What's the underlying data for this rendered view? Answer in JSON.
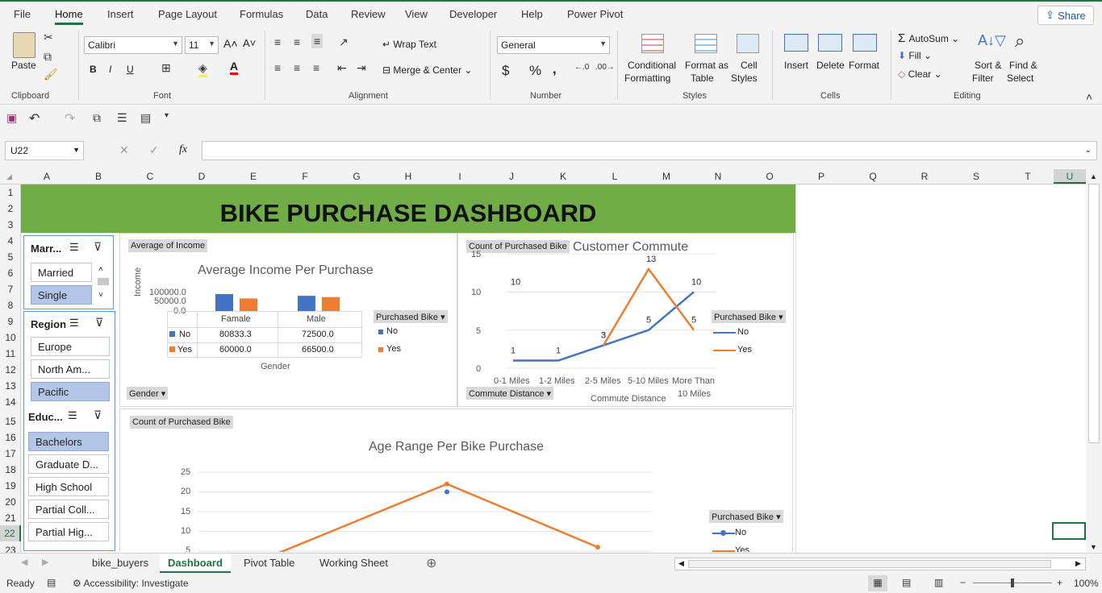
{
  "menu": {
    "tabs": [
      "File",
      "Home",
      "Insert",
      "Page Layout",
      "Formulas",
      "Data",
      "Review",
      "View",
      "Developer",
      "Help",
      "Power Pivot"
    ],
    "share": "Share"
  },
  "ribbon": {
    "clipboard": {
      "paste": "Paste",
      "label": "Clipboard"
    },
    "font": {
      "name": "Calibri",
      "size": "11",
      "label": "Font",
      "bold": "B",
      "italic": "I",
      "underline": "U"
    },
    "alignment": {
      "wrap": "Wrap Text",
      "merge": "Merge & Center",
      "label": "Alignment"
    },
    "number": {
      "format": "General",
      "currency": "$",
      "percent": "%",
      "comma": ",",
      "label": "Number"
    },
    "styles": {
      "conditional": "Conditional",
      "conditional2": "Formatting",
      "format_table": "Format as",
      "format_table2": "Table",
      "cell_styles": "Cell",
      "cell_styles2": "Styles",
      "label": "Styles"
    },
    "cells": {
      "insert": "Insert",
      "delete": "Delete",
      "format": "Format",
      "label": "Cells"
    },
    "editing": {
      "autosum": "AutoSum",
      "fill": "Fill",
      "clear": "Clear",
      "sort": "Sort &",
      "sort2": "Filter",
      "find": "Find &",
      "find2": "Select",
      "label": "Editing"
    }
  },
  "formula_bar": {
    "name_box": "U22",
    "fx": "fx"
  },
  "columns": [
    "A",
    "B",
    "C",
    "D",
    "E",
    "F",
    "G",
    "H",
    "I",
    "J",
    "K",
    "L",
    "M",
    "N",
    "O",
    "P",
    "Q",
    "R",
    "S",
    "T",
    "U"
  ],
  "rows": [
    "1",
    "2",
    "3",
    "4",
    "5",
    "6",
    "7",
    "8",
    "9",
    "10",
    "11",
    "12",
    "13",
    "14",
    "15",
    "16",
    "17",
    "18",
    "19",
    "20",
    "21",
    "22",
    "23"
  ],
  "dashboard": {
    "title": "BIKE PURCHASE DASHBOARD"
  },
  "slicers": {
    "marital": {
      "title": "Marr...",
      "items": [
        "Married",
        "Single"
      ]
    },
    "region": {
      "title": "Region",
      "items": [
        "Europe",
        "North Am...",
        "Pacific"
      ]
    },
    "education": {
      "title": "Educ...",
      "items": [
        "Bachelors",
        "Graduate D...",
        "High School",
        "Partial Coll...",
        "Partial Hig..."
      ]
    }
  },
  "chart_income": {
    "field_top": "Average of Income",
    "field_bottom": "Gender",
    "legend_field": "Purchased Bike",
    "yaxis_label": "Income",
    "xaxis_label": "Gender",
    "ticks": [
      "100000.0",
      "50000.0",
      "0.0"
    ],
    "table": {
      "header": [
        "Famale",
        "Male"
      ],
      "rows": [
        {
          "label": "No",
          "values": [
            "80833.3",
            "72500.0"
          ]
        },
        {
          "label": "Yes",
          "values": [
            "60000.0",
            "66500.0"
          ]
        }
      ]
    }
  },
  "chart_commute": {
    "field_top": "Count of Purchased Bike",
    "field_bottom": "Commute Distance",
    "legend_field": "Purchased Bike",
    "xaxis_label": "Commute Distance",
    "ticks": [
      "15",
      "10",
      "5",
      "0"
    ],
    "xlabels": [
      "0-1 Miles",
      "1-2 Miles",
      "2-5 Miles",
      "5-10 Miles",
      "More Than",
      "10 Miles"
    ]
  },
  "chart_age": {
    "field_top": "Count of Purchased Bike",
    "legend_field": "Purchased Bike",
    "ticks": [
      "25",
      "20",
      "15",
      "10",
      "5"
    ]
  },
  "chart_data": [
    {
      "type": "bar",
      "title": "Average Income Per Purchase",
      "xlabel": "Gender",
      "ylabel": "Income",
      "categories": [
        "Famale",
        "Male"
      ],
      "series": [
        {
          "name": "No",
          "values": [
            80833.3,
            72500.0
          ]
        },
        {
          "name": "Yes",
          "values": [
            60000.0,
            66500.0
          ]
        }
      ],
      "ylim": [
        0,
        100000
      ],
      "colors": {
        "No": "#4472c4",
        "Yes": "#ed7d31"
      }
    },
    {
      "type": "line",
      "title": "Customer Commute",
      "xlabel": "Commute Distance",
      "categories": [
        "0-1 Miles",
        "1-2 Miles",
        "2-5 Miles",
        "5-10 Miles",
        "More Than 10 Miles"
      ],
      "series": [
        {
          "name": "No",
          "values": [
            1,
            1,
            3,
            5,
            10
          ]
        },
        {
          "name": "Yes",
          "values": [
            10,
            null,
            3,
            13,
            5
          ]
        }
      ],
      "ylim": [
        0,
        15
      ],
      "colors": {
        "No": "#4472c4",
        "Yes": "#ed7d31"
      }
    },
    {
      "type": "line",
      "title": "Age Range Per Bike Purchase",
      "series": [
        {
          "name": "No",
          "values": [
            null,
            20,
            null
          ]
        },
        {
          "name": "Yes",
          "values": [
            4,
            22,
            6
          ]
        }
      ],
      "ylim": [
        5,
        25
      ],
      "colors": {
        "No": "#4472c4",
        "Yes": "#ed7d31"
      }
    }
  ],
  "sheets": [
    "bike_buyers",
    "Dashboard",
    "Pivot Table",
    "Working Sheet"
  ],
  "status": {
    "ready": "Ready",
    "accessibility": "Accessibility: Investigate",
    "zoom": "100%"
  }
}
